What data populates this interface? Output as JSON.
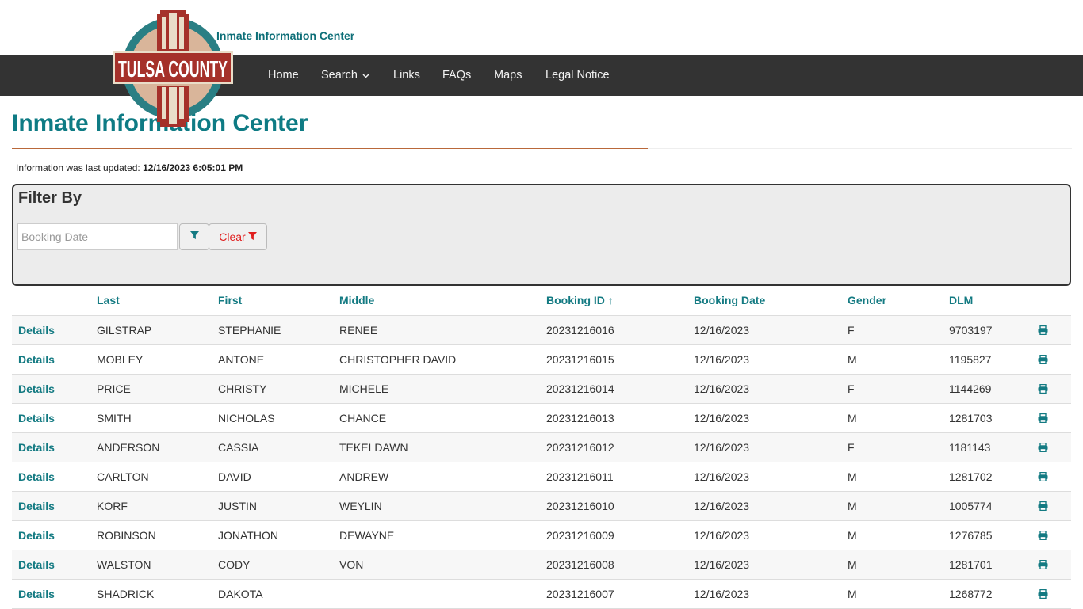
{
  "header": {
    "logo_text": "TULSA COUNTY",
    "site_subtitle": "Inmate Information Center"
  },
  "nav": {
    "items": [
      "Home",
      "Search",
      "Links",
      "FAQs",
      "Maps",
      "Legal Notice"
    ],
    "dropdown_icon": "chevron-down-icon"
  },
  "page": {
    "title": "Inmate Information Center",
    "updated_label": "Information was last updated:",
    "updated_value": "12/16/2023 6:05:01 PM"
  },
  "filter": {
    "title": "Filter By",
    "date_placeholder": "Booking Date",
    "filter_icon": "filter-icon",
    "clear_label": "Clear"
  },
  "table": {
    "columns": [
      "Last",
      "First",
      "Middle",
      "Booking ID",
      "Booking Date",
      "Gender",
      "DLM"
    ],
    "sort_indicator": "↑",
    "details_label": "Details",
    "print_icon": "print-icon",
    "rows": [
      {
        "last": "GILSTRAP",
        "first": "STEPHANIE",
        "middle": "RENEE",
        "booking_id": "20231216016",
        "booking_date": "12/16/2023",
        "gender": "F",
        "dlm": "9703197"
      },
      {
        "last": "MOBLEY",
        "first": "ANTONE",
        "middle": "CHRISTOPHER DAVID",
        "booking_id": "20231216015",
        "booking_date": "12/16/2023",
        "gender": "M",
        "dlm": "1195827"
      },
      {
        "last": "PRICE",
        "first": "CHRISTY",
        "middle": "MICHELE",
        "booking_id": "20231216014",
        "booking_date": "12/16/2023",
        "gender": "F",
        "dlm": "1144269"
      },
      {
        "last": "SMITH",
        "first": "NICHOLAS",
        "middle": "CHANCE",
        "booking_id": "20231216013",
        "booking_date": "12/16/2023",
        "gender": "M",
        "dlm": "1281703"
      },
      {
        "last": "ANDERSON",
        "first": "CASSIA",
        "middle": "TEKELDAWN",
        "booking_id": "20231216012",
        "booking_date": "12/16/2023",
        "gender": "F",
        "dlm": "1181143"
      },
      {
        "last": "CARLTON",
        "first": "DAVID",
        "middle": "ANDREW",
        "booking_id": "20231216011",
        "booking_date": "12/16/2023",
        "gender": "M",
        "dlm": "1281702"
      },
      {
        "last": "KORF",
        "first": "JUSTIN",
        "middle": "WEYLIN",
        "booking_id": "20231216010",
        "booking_date": "12/16/2023",
        "gender": "M",
        "dlm": "1005774"
      },
      {
        "last": "ROBINSON",
        "first": "JONATHON",
        "middle": "DEWAYNE",
        "booking_id": "20231216009",
        "booking_date": "12/16/2023",
        "gender": "M",
        "dlm": "1276785"
      },
      {
        "last": "WALSTON",
        "first": "CODY",
        "middle": "VON",
        "booking_id": "20231216008",
        "booking_date": "12/16/2023",
        "gender": "M",
        "dlm": "1281701"
      },
      {
        "last": "SHADRICK",
        "first": "DAKOTA",
        "middle": "",
        "booking_id": "20231216007",
        "booking_date": "12/16/2023",
        "gender": "M",
        "dlm": "1268772"
      }
    ]
  },
  "colors": {
    "accent": "#137a82",
    "title": "#0e7b84",
    "nav_bg": "#333333",
    "rule": "#b9683a",
    "clear": "#e01e1e",
    "logo_red": "#a5312a",
    "logo_teal": "#2a7f84"
  }
}
